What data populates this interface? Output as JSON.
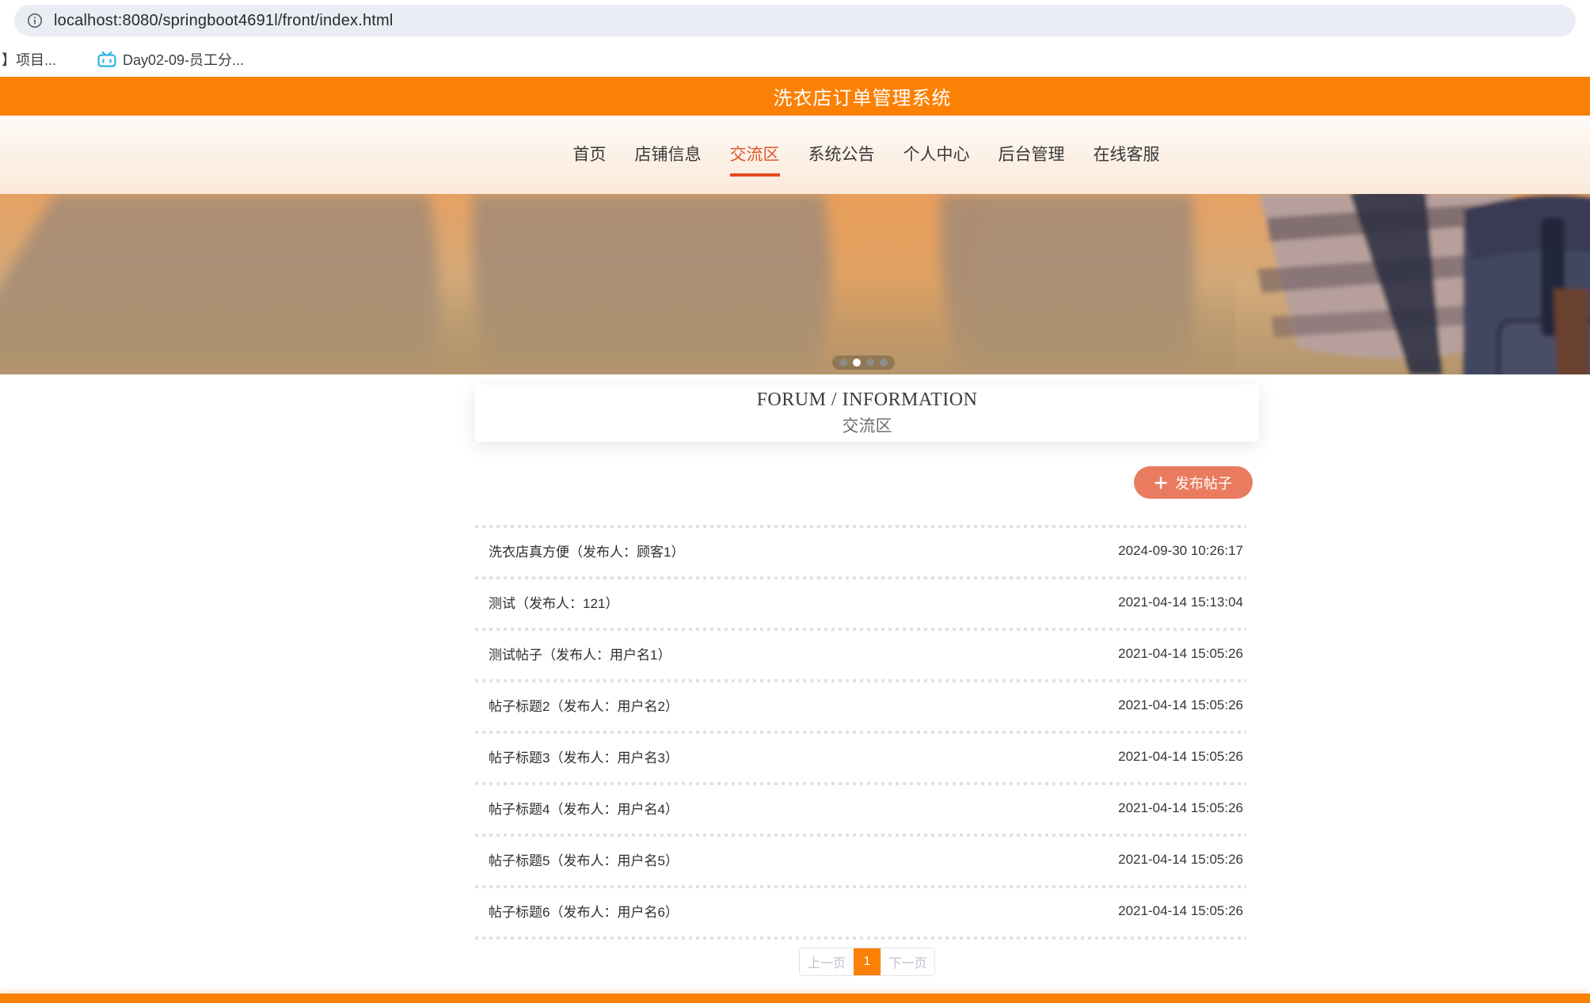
{
  "browser": {
    "url": "localhost:8080/springboot4691l/front/index.html",
    "bookmarks": [
      {
        "label": "】项目..."
      },
      {
        "label": "Day02-09-员工分..."
      }
    ]
  },
  "header": {
    "title": "洗衣店订单管理系统"
  },
  "nav": {
    "items": [
      {
        "label": "首页",
        "active": false
      },
      {
        "label": "店铺信息",
        "active": false
      },
      {
        "label": "交流区",
        "active": true
      },
      {
        "label": "系统公告",
        "active": false
      },
      {
        "label": "个人中心",
        "active": false
      },
      {
        "label": "后台管理",
        "active": false
      },
      {
        "label": "在线客服",
        "active": false
      }
    ]
  },
  "carousel": {
    "dots": [
      {
        "active": false
      },
      {
        "active": true
      },
      {
        "active": false
      },
      {
        "active": false
      }
    ]
  },
  "forum": {
    "eyebrow": "FORUM / INFORMATION",
    "title": "交流区",
    "new_post_label": "发布帖子"
  },
  "posts": [
    {
      "title": "洗衣店真方便（发布人：顾客1）",
      "time": "2024-09-30 10:26:17"
    },
    {
      "title": "测试（发布人：121）",
      "time": "2021-04-14 15:13:04"
    },
    {
      "title": "测试帖子（发布人：用户名1）",
      "time": "2021-04-14 15:05:26"
    },
    {
      "title": "帖子标题2（发布人：用户名2）",
      "time": "2021-04-14 15:05:26"
    },
    {
      "title": "帖子标题3（发布人：用户名3）",
      "time": "2021-04-14 15:05:26"
    },
    {
      "title": "帖子标题4（发布人：用户名4）",
      "time": "2021-04-14 15:05:26"
    },
    {
      "title": "帖子标题5（发布人：用户名5）",
      "time": "2021-04-14 15:05:26"
    },
    {
      "title": "帖子标题6（发布人：用户名6）",
      "time": "2021-04-14 15:05:26"
    }
  ],
  "pagination": {
    "prev_label": "上一页",
    "current_page": "1",
    "next_label": "下一页"
  },
  "colors": {
    "accent": "#fb8106",
    "nav_active": "#e0552c",
    "nav_underline": "#e4491f",
    "salmon": "#e97c5f"
  }
}
